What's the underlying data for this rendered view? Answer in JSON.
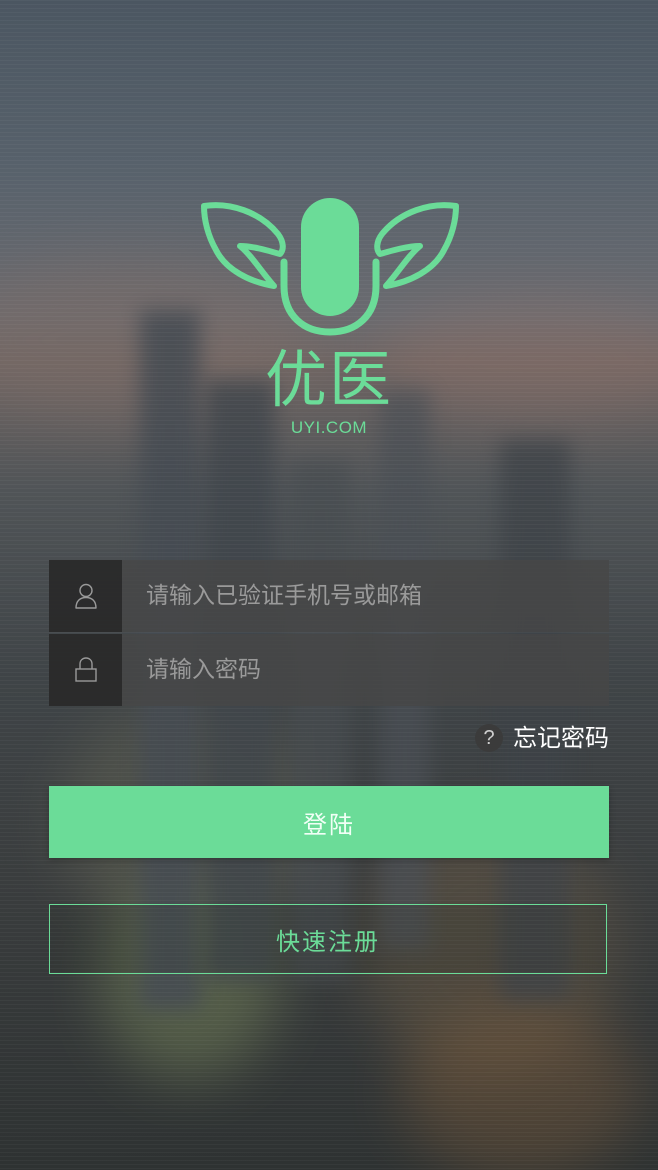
{
  "brand": {
    "name": "优医",
    "domain": "UYI.COM",
    "accent_color": "#6bdc98"
  },
  "login_form": {
    "username": {
      "icon": "user-icon",
      "placeholder": "请输入已验证手机号或邮箱",
      "value": ""
    },
    "password": {
      "icon": "lock-icon",
      "placeholder": "请输入密码",
      "value": ""
    },
    "forgot_password": {
      "icon": "question-icon",
      "icon_glyph": "?",
      "label": "忘记密码"
    },
    "login_label": "登陆",
    "register_label": "快速注册"
  }
}
